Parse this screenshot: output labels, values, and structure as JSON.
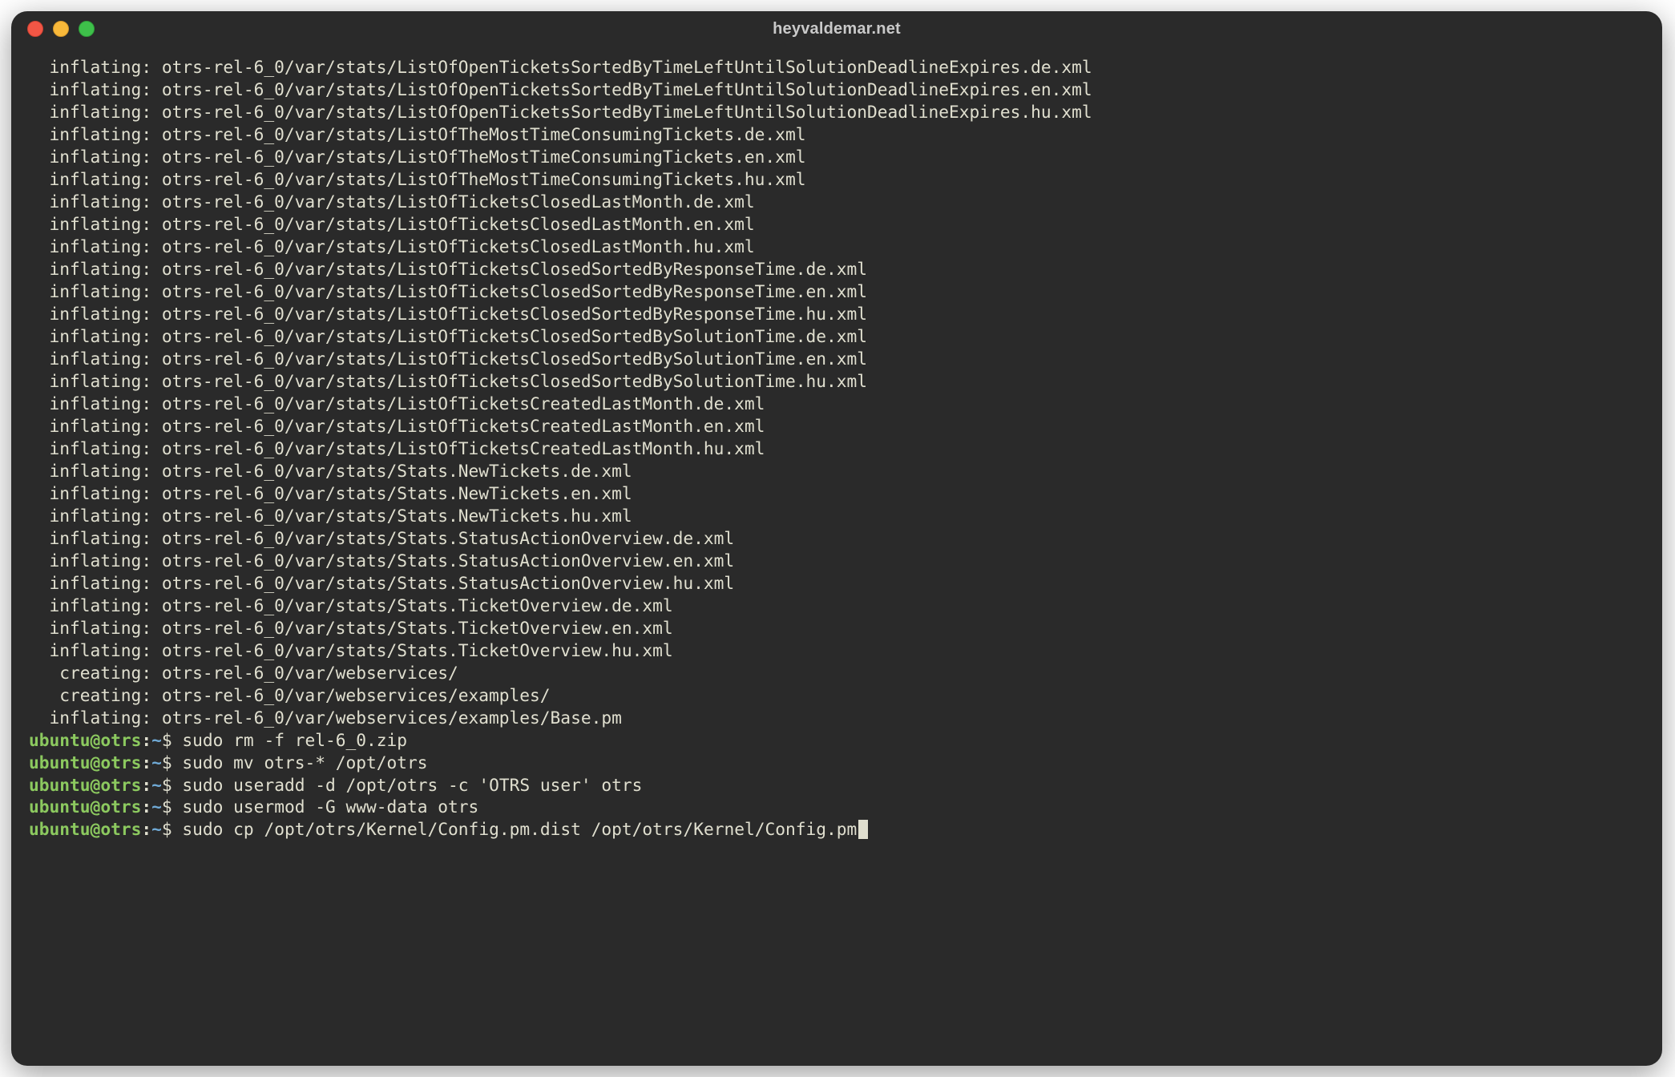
{
  "window": {
    "title": "heyvaldemar.net"
  },
  "terminal": {
    "indent": "  ",
    "inflating_prefix": "inflating: ",
    "creating_prefix": " creating: ",
    "output": [
      {
        "kind": "inflating",
        "path": "otrs-rel-6_0/var/stats/ListOfOpenTicketsSortedByTimeLeftUntilSolutionDeadlineExpires.de.xml"
      },
      {
        "kind": "inflating",
        "path": "otrs-rel-6_0/var/stats/ListOfOpenTicketsSortedByTimeLeftUntilSolutionDeadlineExpires.en.xml"
      },
      {
        "kind": "inflating",
        "path": "otrs-rel-6_0/var/stats/ListOfOpenTicketsSortedByTimeLeftUntilSolutionDeadlineExpires.hu.xml"
      },
      {
        "kind": "inflating",
        "path": "otrs-rel-6_0/var/stats/ListOfTheMostTimeConsumingTickets.de.xml"
      },
      {
        "kind": "inflating",
        "path": "otrs-rel-6_0/var/stats/ListOfTheMostTimeConsumingTickets.en.xml"
      },
      {
        "kind": "inflating",
        "path": "otrs-rel-6_0/var/stats/ListOfTheMostTimeConsumingTickets.hu.xml"
      },
      {
        "kind": "inflating",
        "path": "otrs-rel-6_0/var/stats/ListOfTicketsClosedLastMonth.de.xml"
      },
      {
        "kind": "inflating",
        "path": "otrs-rel-6_0/var/stats/ListOfTicketsClosedLastMonth.en.xml"
      },
      {
        "kind": "inflating",
        "path": "otrs-rel-6_0/var/stats/ListOfTicketsClosedLastMonth.hu.xml"
      },
      {
        "kind": "inflating",
        "path": "otrs-rel-6_0/var/stats/ListOfTicketsClosedSortedByResponseTime.de.xml"
      },
      {
        "kind": "inflating",
        "path": "otrs-rel-6_0/var/stats/ListOfTicketsClosedSortedByResponseTime.en.xml"
      },
      {
        "kind": "inflating",
        "path": "otrs-rel-6_0/var/stats/ListOfTicketsClosedSortedByResponseTime.hu.xml"
      },
      {
        "kind": "inflating",
        "path": "otrs-rel-6_0/var/stats/ListOfTicketsClosedSortedBySolutionTime.de.xml"
      },
      {
        "kind": "inflating",
        "path": "otrs-rel-6_0/var/stats/ListOfTicketsClosedSortedBySolutionTime.en.xml"
      },
      {
        "kind": "inflating",
        "path": "otrs-rel-6_0/var/stats/ListOfTicketsClosedSortedBySolutionTime.hu.xml"
      },
      {
        "kind": "inflating",
        "path": "otrs-rel-6_0/var/stats/ListOfTicketsCreatedLastMonth.de.xml"
      },
      {
        "kind": "inflating",
        "path": "otrs-rel-6_0/var/stats/ListOfTicketsCreatedLastMonth.en.xml"
      },
      {
        "kind": "inflating",
        "path": "otrs-rel-6_0/var/stats/ListOfTicketsCreatedLastMonth.hu.xml"
      },
      {
        "kind": "inflating",
        "path": "otrs-rel-6_0/var/stats/Stats.NewTickets.de.xml"
      },
      {
        "kind": "inflating",
        "path": "otrs-rel-6_0/var/stats/Stats.NewTickets.en.xml"
      },
      {
        "kind": "inflating",
        "path": "otrs-rel-6_0/var/stats/Stats.NewTickets.hu.xml"
      },
      {
        "kind": "inflating",
        "path": "otrs-rel-6_0/var/stats/Stats.StatusActionOverview.de.xml"
      },
      {
        "kind": "inflating",
        "path": "otrs-rel-6_0/var/stats/Stats.StatusActionOverview.en.xml"
      },
      {
        "kind": "inflating",
        "path": "otrs-rel-6_0/var/stats/Stats.StatusActionOverview.hu.xml"
      },
      {
        "kind": "inflating",
        "path": "otrs-rel-6_0/var/stats/Stats.TicketOverview.de.xml"
      },
      {
        "kind": "inflating",
        "path": "otrs-rel-6_0/var/stats/Stats.TicketOverview.en.xml"
      },
      {
        "kind": "inflating",
        "path": "otrs-rel-6_0/var/stats/Stats.TicketOverview.hu.xml"
      },
      {
        "kind": "creating",
        "path": "otrs-rel-6_0/var/webservices/"
      },
      {
        "kind": "creating",
        "path": "otrs-rel-6_0/var/webservices/examples/"
      },
      {
        "kind": "inflating",
        "path": "otrs-rel-6_0/var/webservices/examples/Base.pm"
      }
    ],
    "prompt": {
      "user": "ubuntu",
      "at": "@",
      "host": "otrs",
      "colon": ":",
      "cwd": "~",
      "sigil": "$ "
    },
    "commands": [
      {
        "text": "sudo rm -f rel-6_0.zip"
      },
      {
        "text": "sudo mv otrs-* /opt/otrs"
      },
      {
        "text": "sudo useradd -d /opt/otrs -c 'OTRS user' otrs"
      },
      {
        "text": "sudo usermod -G www-data otrs"
      },
      {
        "text": "sudo cp /opt/otrs/Kernel/Config.pm.dist /opt/otrs/Kernel/Config.pm",
        "cursor": true
      }
    ]
  }
}
